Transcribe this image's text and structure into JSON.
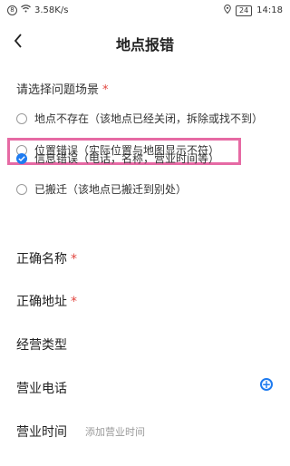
{
  "status_bar": {
    "speed": "3.58K/s",
    "badge": "8",
    "battery": "24",
    "time": "14:18"
  },
  "header": {
    "title": "地点报错"
  },
  "scenario": {
    "title": "请选择问题场景",
    "required": "*",
    "options": [
      {
        "label": "地点不存在（该地点已经关闭，拆除或找不到）",
        "selected": false
      },
      {
        "label": "位置错误（实际位置与地图显示不符）",
        "selected": false
      },
      {
        "label": "信息错误（电话，名称，营业时间等）",
        "selected": true
      },
      {
        "label": "已搬迁（该地点已搬迁到别处）",
        "selected": false
      }
    ]
  },
  "fields": {
    "correct_name": {
      "label": "正确名称",
      "required": "*"
    },
    "correct_address": {
      "label": "正确地址",
      "required": "*"
    },
    "business_type": {
      "label": "经营类型"
    },
    "business_phone": {
      "label": "营业电话"
    },
    "business_hours": {
      "label": "营业时间",
      "placeholder": "添加营业时间"
    }
  },
  "colors": {
    "accent": "#1e7bf0",
    "required": "#e2463f",
    "highlight": "#e66aa4"
  }
}
